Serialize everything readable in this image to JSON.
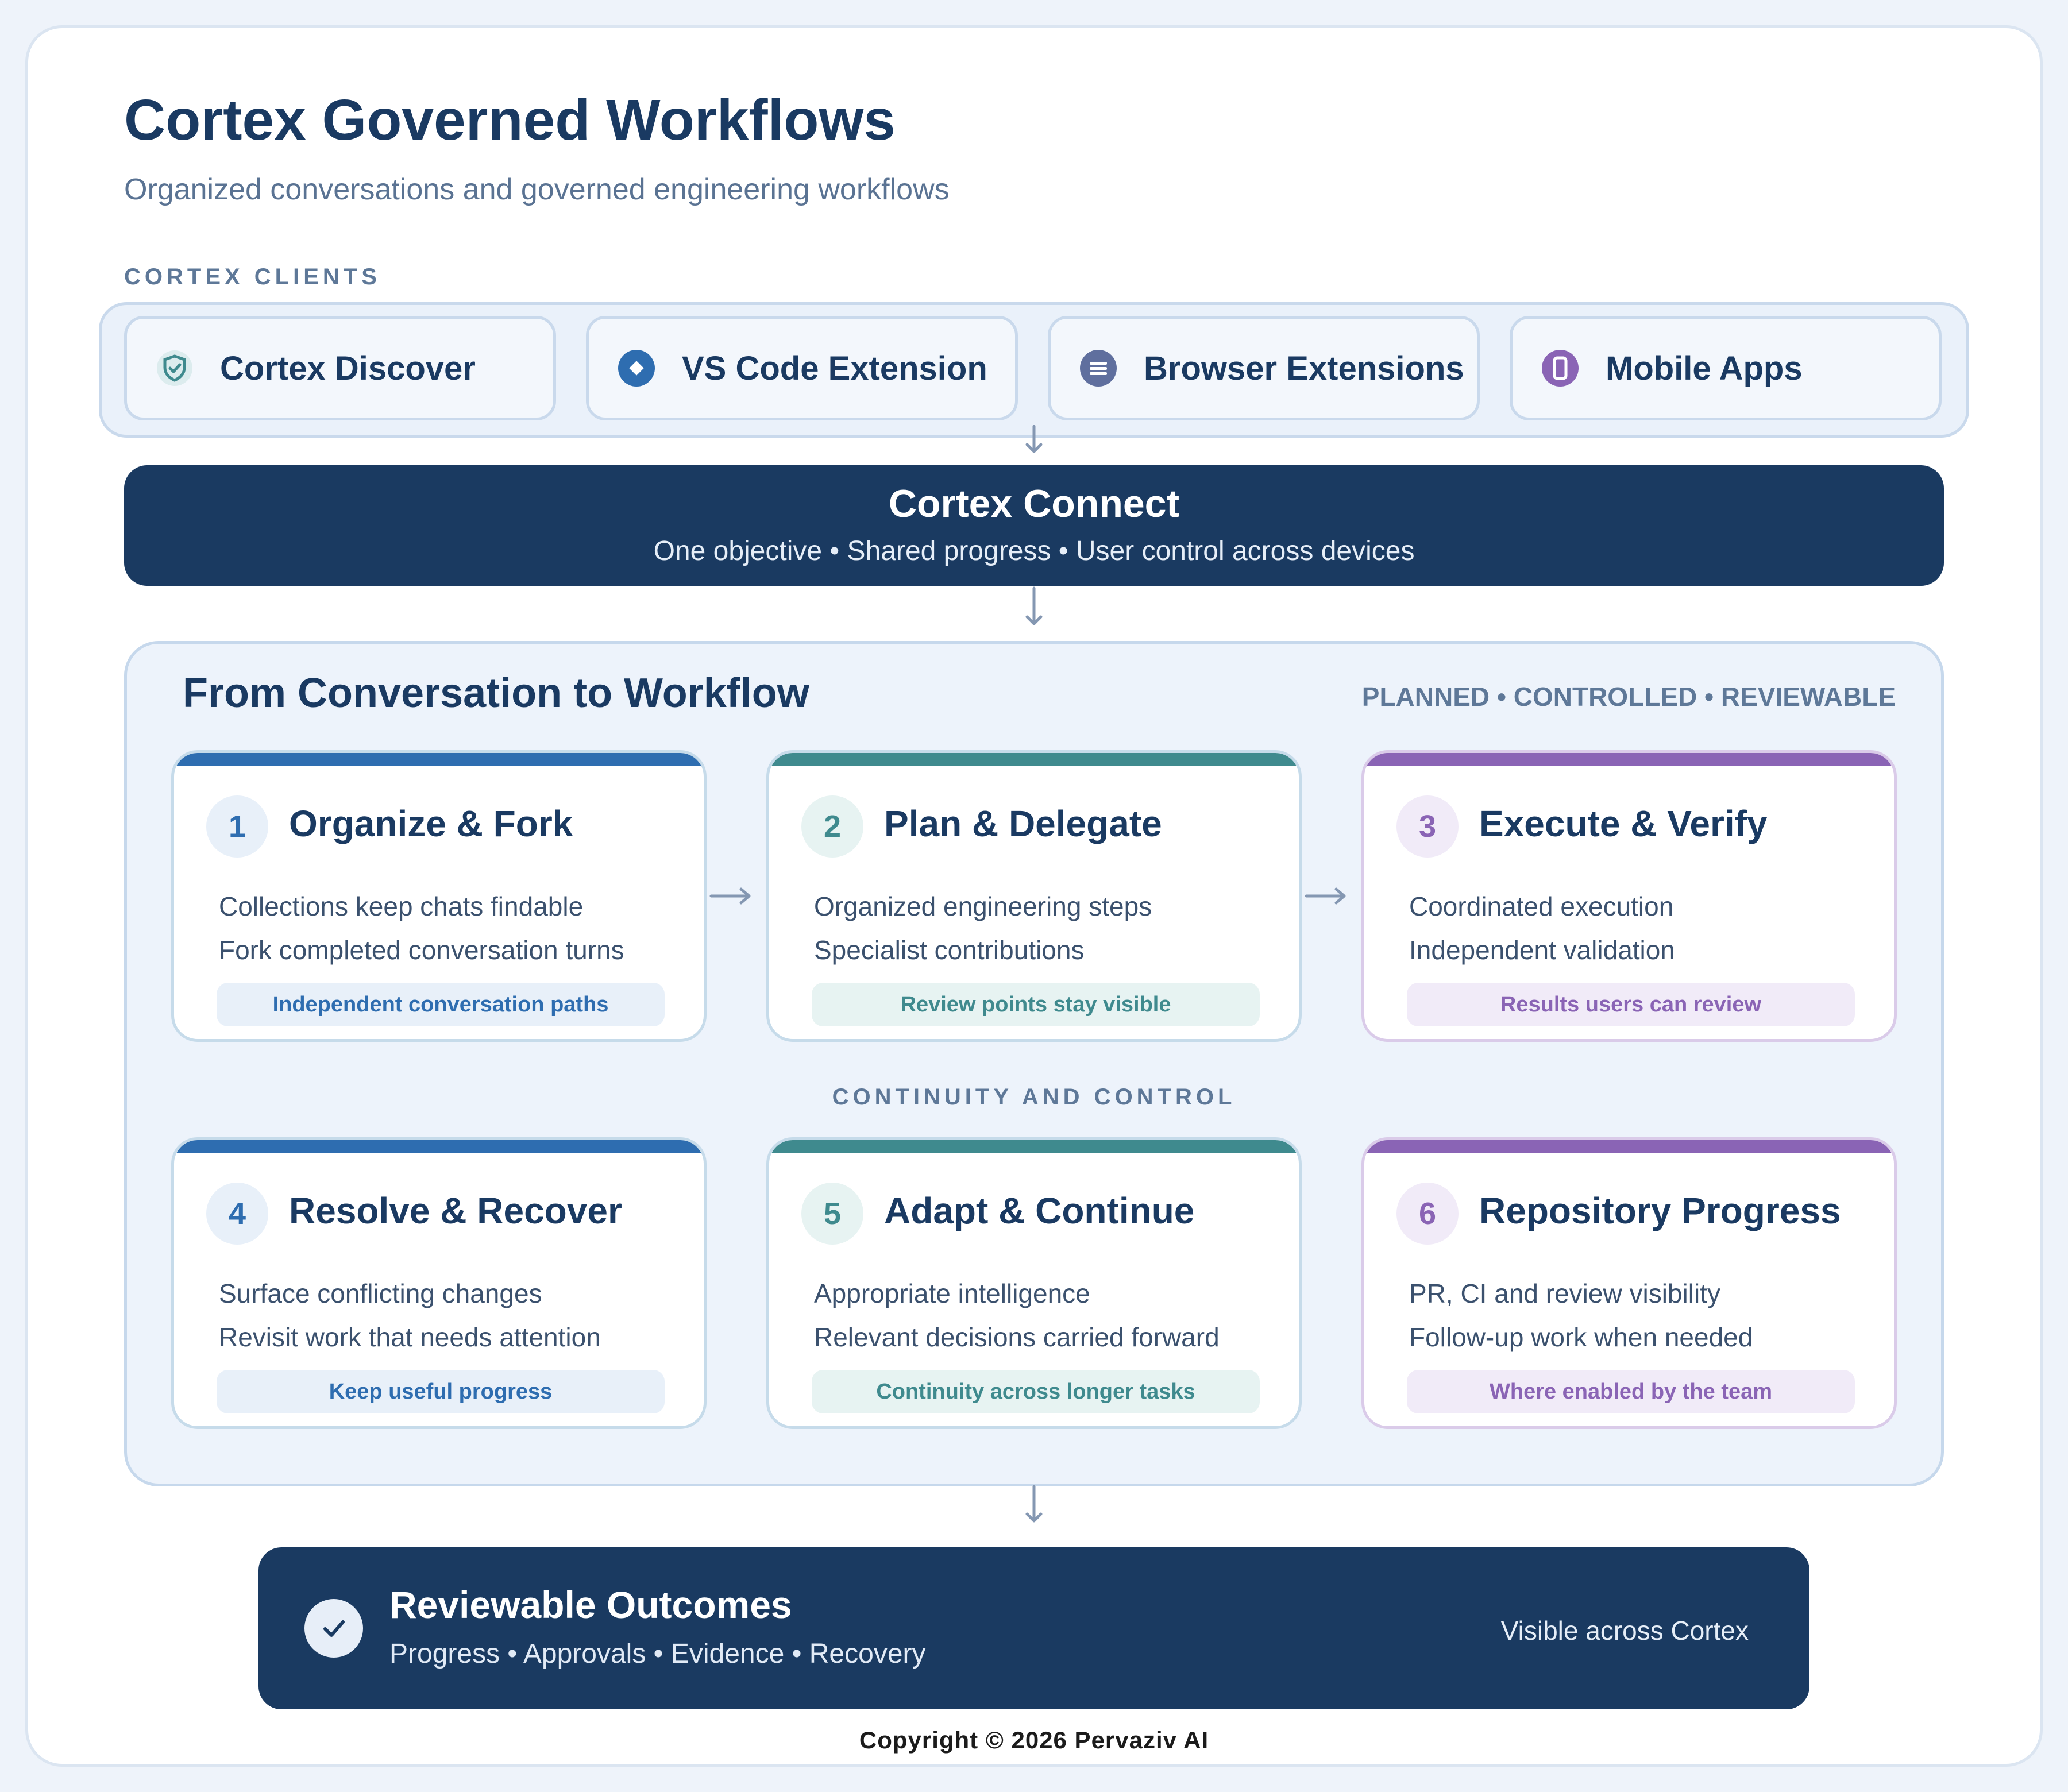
{
  "header": {
    "title": "Cortex Governed Workflows",
    "subtitle": "Organized conversations and governed engineering workflows"
  },
  "clients": {
    "section_label": "CORTEX CLIENTS",
    "items": [
      {
        "label": "Cortex Discover",
        "icon": "shield-check-icon",
        "color": "#3f8a8e"
      },
      {
        "label": "VS Code Extension",
        "icon": "diamond-icon",
        "color": "#2e6db0"
      },
      {
        "label": "Browser Extensions",
        "icon": "lines-icon",
        "color": "#5f6f9e"
      },
      {
        "label": "Mobile Apps",
        "icon": "phone-icon",
        "color": "#8a64b5"
      }
    ]
  },
  "connect": {
    "title": "Cortex Connect",
    "subtitle": "One objective • Shared progress • User control across devices"
  },
  "workflow": {
    "title": "From Conversation to Workflow",
    "tagline": "PLANNED • CONTROLLED • REVIEWABLE",
    "divider_label": "CONTINUITY AND CONTROL",
    "steps": [
      {
        "number": "1",
        "title": "Organize & Fork",
        "lines": [
          "Collections keep chats findable",
          "Fork completed conversation turns"
        ],
        "pill": "Independent conversation paths",
        "accent": "#2e6db0"
      },
      {
        "number": "2",
        "title": "Plan & Delegate",
        "lines": [
          "Organized engineering steps",
          "Specialist contributions"
        ],
        "pill": "Review points stay visible",
        "accent": "#3f8a8e"
      },
      {
        "number": "3",
        "title": "Execute & Verify",
        "lines": [
          "Coordinated execution",
          "Independent validation"
        ],
        "pill": "Results users can review",
        "accent": "#8a64b5"
      },
      {
        "number": "4",
        "title": "Resolve & Recover",
        "lines": [
          "Surface conflicting changes",
          "Revisit work that needs attention"
        ],
        "pill": "Keep useful progress",
        "accent": "#2e6db0"
      },
      {
        "number": "5",
        "title": "Adapt & Continue",
        "lines": [
          "Appropriate intelligence",
          "Relevant decisions carried forward"
        ],
        "pill": "Continuity across longer tasks",
        "accent": "#3f8a8e"
      },
      {
        "number": "6",
        "title": "Repository Progress",
        "lines": [
          "PR, CI and review visibility",
          "Follow-up work when needed"
        ],
        "pill": "Where enabled by the team",
        "accent": "#8a64b5"
      }
    ]
  },
  "outcomes": {
    "title": "Reviewable Outcomes",
    "subtitle": "Progress • Approvals • Evidence • Recovery",
    "right_note": "Visible across Cortex",
    "icon": "checkmark-icon"
  },
  "footer": {
    "copyright": "Copyright © 2026 Pervaziv AI"
  }
}
